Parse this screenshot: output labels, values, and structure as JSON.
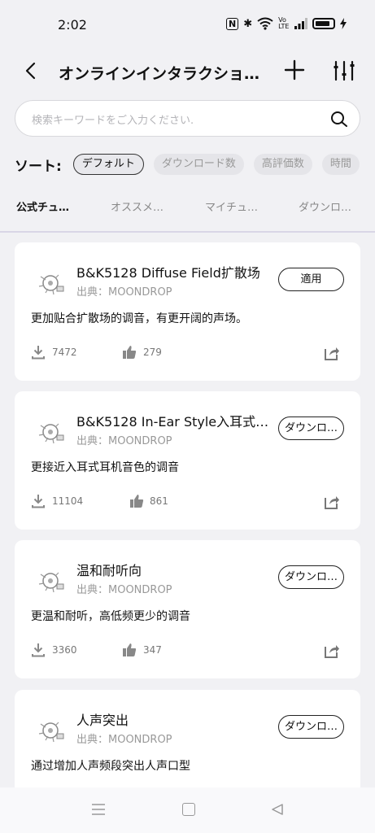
{
  "status": {
    "time": "2:02",
    "nfc": "N",
    "bluetooth": "✱",
    "network": "VoLTE"
  },
  "header": {
    "title": "オンラインインタラクショ…",
    "back_icon": "back-chevron-icon",
    "add_icon": "plus-icon",
    "settings_icon": "equalizer-icon"
  },
  "search": {
    "placeholder": "検索キーワードをご入力ください."
  },
  "sort": {
    "label": "ソート:",
    "options": [
      {
        "label": "デフォルト",
        "active": true
      },
      {
        "label": "ダウンロード数",
        "active": false
      },
      {
        "label": "高評価数",
        "active": false
      },
      {
        "label": "時間",
        "active": false
      }
    ]
  },
  "tabs": [
    {
      "label": "公式チュ…",
      "active": true
    },
    {
      "label": "オススメ…",
      "active": false
    },
    {
      "label": "マイチュ…",
      "active": false
    },
    {
      "label": "ダウンロ…",
      "active": false
    }
  ],
  "cards": [
    {
      "name": "B&K5128 Diffuse Field扩散场",
      "source": "出典：MOONDROP",
      "button": "適用",
      "description": "更加贴合扩散场的调音，有更开阔的声场。",
      "downloads": "7472",
      "likes": "279"
    },
    {
      "name": "B&K5128 In-Ear Style入耳式…",
      "source": "出典：MOONDROP",
      "button": "ダウンロ…",
      "description": "更接近入耳式耳机音色的调音",
      "downloads": "11104",
      "likes": "861"
    },
    {
      "name": "温和耐听向",
      "source": "出典：MOONDROP",
      "button": "ダウンロ…",
      "description": "更温和耐听，高低频更少的调音",
      "downloads": "3360",
      "likes": "347"
    },
    {
      "name": "人声突出",
      "source": "出典：MOONDROP",
      "button": "ダウンロ…",
      "description": "通过增加人声频段突出人声口型",
      "downloads": "",
      "likes": ""
    }
  ],
  "colors": {
    "background": "#f1f1f4",
    "card": "#ffffff",
    "text": "#111111",
    "muted": "#999999",
    "divider": "#d9d6e6"
  }
}
